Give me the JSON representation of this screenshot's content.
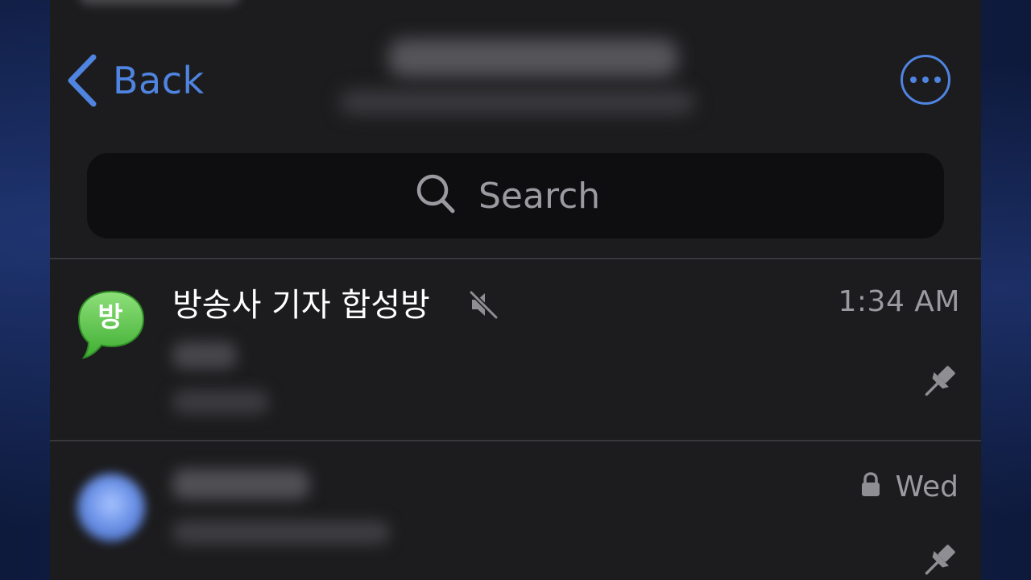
{
  "nav": {
    "back_label": "Back",
    "back_icon": "chevron-left-icon",
    "more_icon": "ellipsis-circle-icon"
  },
  "search": {
    "placeholder": "Search",
    "icon": "search-icon"
  },
  "chats": [
    {
      "avatar_char": "방",
      "avatar_color": "#5cc94a",
      "name": "방송사 기자 합성방",
      "muted": true,
      "time": "1:34 AM",
      "pinned": true
    },
    {
      "avatar_color": "#7aa0f0",
      "time": "Wed",
      "locked": true,
      "pinned": true
    }
  ],
  "colors": {
    "accent": "#4f84e0",
    "background": "#1c1c1e",
    "search_background": "#0e0e10",
    "secondary_text": "#9a9aa0"
  }
}
